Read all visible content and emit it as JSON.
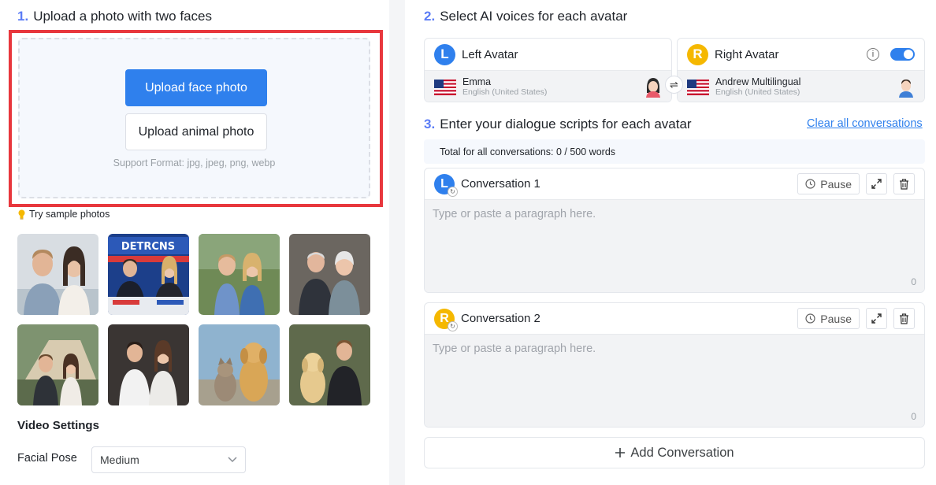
{
  "upload": {
    "step": "1.",
    "title": "Upload a photo with two faces",
    "face_button": "Upload face photo",
    "animal_button": "Upload animal photo",
    "support": "Support Format: jpg, jpeg, png, webp",
    "sample_title": "Try sample photos"
  },
  "video_settings": {
    "title": "Video Settings",
    "facial_pose_label": "Facial Pose",
    "facial_pose_value": "Medium"
  },
  "voices": {
    "step": "2.",
    "title": "Select AI voices for each avatar",
    "left": {
      "badge": "L",
      "label": "Left Avatar",
      "voice": "Emma",
      "lang": "English (United States)"
    },
    "right": {
      "badge": "R",
      "label": "Right Avatar",
      "voice": "Andrew Multilingual",
      "lang": "English (United States)",
      "toggle_on": true
    }
  },
  "scripts": {
    "step": "3.",
    "title": "Enter your dialogue scripts for each avatar",
    "clear_all": "Clear all conversations",
    "total": "Total for all conversations: 0 / 500 words",
    "conversations": [
      {
        "badge": "L",
        "title": "Conversation 1",
        "pause": "Pause",
        "placeholder": "Type or paste a paragraph here.",
        "count": "0"
      },
      {
        "badge": "R",
        "title": "Conversation 2",
        "pause": "Pause",
        "placeholder": "Type or paste a paragraph here.",
        "count": "0"
      }
    ],
    "add": "Add Conversation"
  },
  "colors": {
    "primary": "#2f80ed",
    "left_badge": "#2f80ed",
    "right_badge": "#f5b800",
    "highlight": "#e8373d"
  }
}
